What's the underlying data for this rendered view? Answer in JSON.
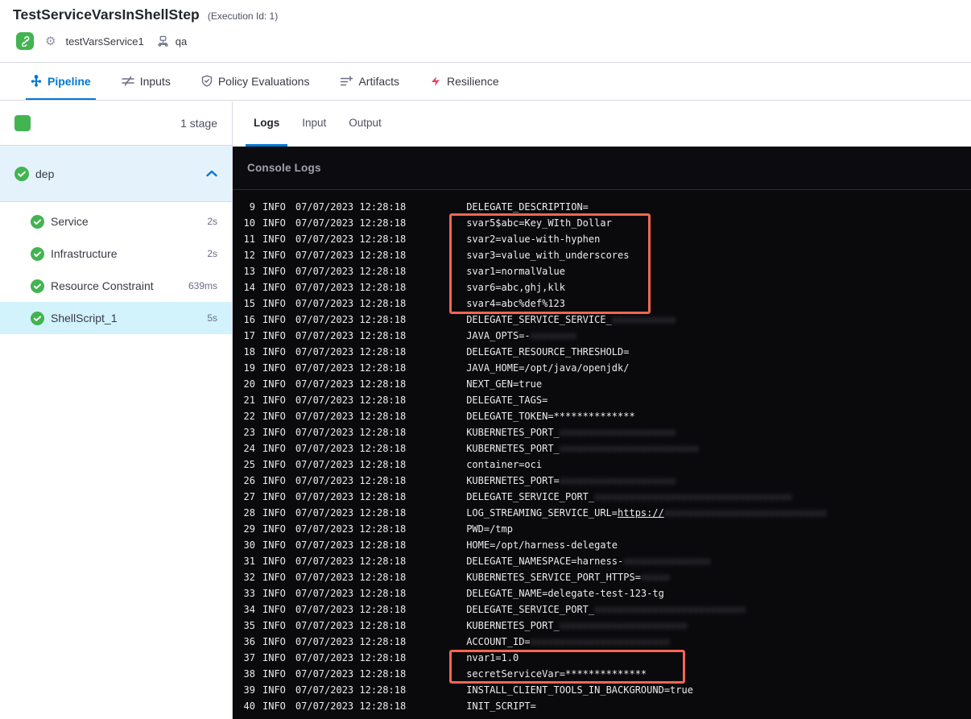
{
  "colors": {
    "accent": "#0278d5",
    "success_green": "#42b450",
    "annotation_red": "#f4664f",
    "selected_step_bg": "#d2f2fc",
    "stage_group_bg": "#e4f3fb"
  },
  "header": {
    "title": "TestServiceVarsInShellStep",
    "execution_id_label": "(Execution Id: 1)",
    "service_name": "testVarsService1",
    "environment_name": "qa"
  },
  "tabbar": {
    "tabs": [
      {
        "label": "Pipeline",
        "active": true
      },
      {
        "label": "Inputs",
        "active": false
      },
      {
        "label": "Policy Evaluations",
        "active": false
      },
      {
        "label": "Artifacts",
        "active": false
      },
      {
        "label": "Resilience",
        "active": false
      }
    ]
  },
  "sidebar": {
    "stage_count_label": "1 stage",
    "stage_group": {
      "name": "dep"
    },
    "steps": [
      {
        "label": "Service",
        "duration": "2s",
        "status": "success",
        "selected": false
      },
      {
        "label": "Infrastructure",
        "duration": "2s",
        "status": "success",
        "selected": false
      },
      {
        "label": "Resource Constraint",
        "duration": "639ms",
        "status": "success",
        "selected": false
      },
      {
        "label": "ShellScript_1",
        "duration": "5s",
        "status": "success",
        "selected": true
      }
    ]
  },
  "log_panel": {
    "tabs": [
      {
        "label": "Logs",
        "active": true
      },
      {
        "label": "Input",
        "active": false
      },
      {
        "label": "Output",
        "active": false
      }
    ],
    "console_title": "Console Logs",
    "lines": [
      {
        "n": "9",
        "level": "INFO",
        "ts": "07/07/2023 12:28:18",
        "msg": "DELEGATE_DESCRIPTION=",
        "redact": "",
        "link": ""
      },
      {
        "n": "10",
        "level": "INFO",
        "ts": "07/07/2023 12:28:18",
        "msg": "svar5$abc=Key_WIth_Dollar",
        "redact": "",
        "link": ""
      },
      {
        "n": "11",
        "level": "INFO",
        "ts": "07/07/2023 12:28:18",
        "msg": "svar2=value-with-hyphen",
        "redact": "",
        "link": ""
      },
      {
        "n": "12",
        "level": "INFO",
        "ts": "07/07/2023 12:28:18",
        "msg": "svar3=value_with_underscores",
        "redact": "",
        "link": ""
      },
      {
        "n": "13",
        "level": "INFO",
        "ts": "07/07/2023 12:28:18",
        "msg": "svar1=normalValue",
        "redact": "",
        "link": ""
      },
      {
        "n": "14",
        "level": "INFO",
        "ts": "07/07/2023 12:28:18",
        "msg": "svar6=abc,ghj,klk",
        "redact": "",
        "link": ""
      },
      {
        "n": "15",
        "level": "INFO",
        "ts": "07/07/2023 12:28:18",
        "msg": "svar4=abc%def%123",
        "redact": "",
        "link": ""
      },
      {
        "n": "16",
        "level": "INFO",
        "ts": "07/07/2023 12:28:18",
        "msg": "DELEGATE_SERVICE_SERVICE_",
        "redact": "xxxxxxxxxxx",
        "link": ""
      },
      {
        "n": "17",
        "level": "INFO",
        "ts": "07/07/2023 12:28:18",
        "msg": "JAVA_OPTS=-",
        "redact": "xxxxxxxx",
        "link": ""
      },
      {
        "n": "18",
        "level": "INFO",
        "ts": "07/07/2023 12:28:18",
        "msg": "DELEGATE_RESOURCE_THRESHOLD=",
        "redact": "",
        "link": ""
      },
      {
        "n": "19",
        "level": "INFO",
        "ts": "07/07/2023 12:28:18",
        "msg": "JAVA_HOME=/opt/java/openjdk/",
        "redact": "",
        "link": ""
      },
      {
        "n": "20",
        "level": "INFO",
        "ts": "07/07/2023 12:28:18",
        "msg": "NEXT_GEN=true",
        "redact": "",
        "link": ""
      },
      {
        "n": "21",
        "level": "INFO",
        "ts": "07/07/2023 12:28:18",
        "msg": "DELEGATE_TAGS=",
        "redact": "",
        "link": ""
      },
      {
        "n": "22",
        "level": "INFO",
        "ts": "07/07/2023 12:28:18",
        "msg": "DELEGATE_TOKEN=**************",
        "redact": "",
        "link": ""
      },
      {
        "n": "23",
        "level": "INFO",
        "ts": "07/07/2023 12:28:18",
        "msg": "KUBERNETES_PORT_",
        "redact": "xxxxxxxxxxxxxxxxxxxx",
        "link": ""
      },
      {
        "n": "24",
        "level": "INFO",
        "ts": "07/07/2023 12:28:18",
        "msg": "KUBERNETES_PORT_",
        "redact": "xxxxxxxxxxxxxxxxxxxxxxxx",
        "link": ""
      },
      {
        "n": "25",
        "level": "INFO",
        "ts": "07/07/2023 12:28:18",
        "msg": "container=oci",
        "redact": "",
        "link": ""
      },
      {
        "n": "26",
        "level": "INFO",
        "ts": "07/07/2023 12:28:18",
        "msg": "KUBERNETES_PORT=",
        "redact": "xxxxxxxxxxxxxxxxxxxx",
        "link": ""
      },
      {
        "n": "27",
        "level": "INFO",
        "ts": "07/07/2023 12:28:18",
        "msg": "DELEGATE_SERVICE_PORT_",
        "redact": "xxxxxxxxxxxxxxxxxxxxxxxxxxxxxxxxxx",
        "link": ""
      },
      {
        "n": "28",
        "level": "INFO",
        "ts": "07/07/2023 12:28:18",
        "msg": "LOG_STREAMING_SERVICE_URL=",
        "redact": "xxxxxxxxxxxxxxxxxxxxxxxxxxxx",
        "link": "https://"
      },
      {
        "n": "29",
        "level": "INFO",
        "ts": "07/07/2023 12:28:18",
        "msg": "PWD=/tmp",
        "redact": "",
        "link": ""
      },
      {
        "n": "30",
        "level": "INFO",
        "ts": "07/07/2023 12:28:18",
        "msg": "HOME=/opt/harness-delegate",
        "redact": "",
        "link": ""
      },
      {
        "n": "31",
        "level": "INFO",
        "ts": "07/07/2023 12:28:18",
        "msg": "DELEGATE_NAMESPACE=harness-",
        "redact": "xxxxxxxxxxxxxxx",
        "link": ""
      },
      {
        "n": "32",
        "level": "INFO",
        "ts": "07/07/2023 12:28:18",
        "msg": "KUBERNETES_SERVICE_PORT_HTTPS=",
        "redact": "xxxxx",
        "link": ""
      },
      {
        "n": "33",
        "level": "INFO",
        "ts": "07/07/2023 12:28:18",
        "msg": "DELEGATE_NAME=delegate-test-123-tg",
        "redact": "",
        "link": ""
      },
      {
        "n": "34",
        "level": "INFO",
        "ts": "07/07/2023 12:28:18",
        "msg": "DELEGATE_SERVICE_PORT_",
        "redact": "xxxxxxxxxxxxxxxxxxxxxxxxxx",
        "link": ""
      },
      {
        "n": "35",
        "level": "INFO",
        "ts": "07/07/2023 12:28:18",
        "msg": "KUBERNETES_PORT_",
        "redact": "xxxxxxxxxxxxxxxxxxxxxx",
        "link": ""
      },
      {
        "n": "36",
        "level": "INFO",
        "ts": "07/07/2023 12:28:18",
        "msg": "ACCOUNT_ID=",
        "redact": "xxxxxxxxxxxxxxxxxxxxxxxx",
        "link": ""
      },
      {
        "n": "37",
        "level": "INFO",
        "ts": "07/07/2023 12:28:18",
        "msg": "nvar1=1.0",
        "redact": "",
        "link": ""
      },
      {
        "n": "38",
        "level": "INFO",
        "ts": "07/07/2023 12:28:18",
        "msg": "secretServiceVar=**************",
        "redact": "",
        "link": ""
      },
      {
        "n": "39",
        "level": "INFO",
        "ts": "07/07/2023 12:28:18",
        "msg": "INSTALL_CLIENT_TOOLS_IN_BACKGROUND=true",
        "redact": "",
        "link": ""
      },
      {
        "n": "40",
        "level": "INFO",
        "ts": "07/07/2023 12:28:18",
        "msg": "INIT_SCRIPT=",
        "redact": "",
        "link": ""
      }
    ]
  }
}
